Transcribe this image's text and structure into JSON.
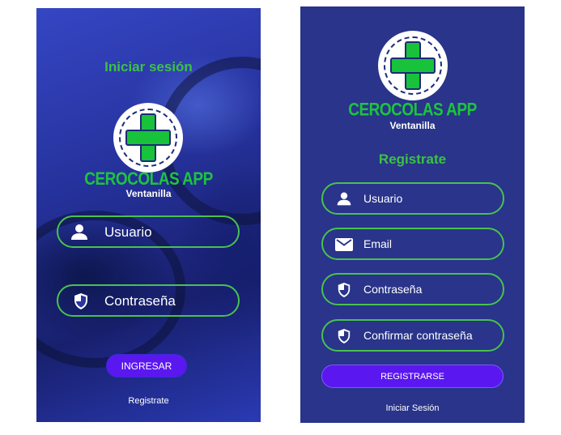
{
  "login": {
    "title": "Iniciar sesión",
    "brand": "CEROCOLAS APP",
    "subbrand": "Ventanilla",
    "fields": [
      {
        "label": "Usuario",
        "icon": "user-icon"
      },
      {
        "label": "Contraseña",
        "icon": "shield-icon"
      }
    ],
    "button": "INGRESAR",
    "link": "Registrate"
  },
  "register": {
    "brand": "CEROCOLAS APP",
    "subbrand": "Ventanilla",
    "title": "Registrate",
    "fields": [
      {
        "label": "Usuario",
        "icon": "user-icon"
      },
      {
        "label": "Email",
        "icon": "email-icon"
      },
      {
        "label": "Contraseña",
        "icon": "shield-icon"
      },
      {
        "label": "Confirmar contraseña",
        "icon": "shield-icon"
      }
    ],
    "button": "REGISTRARSE",
    "link": "Iniciar Sesión"
  },
  "colors": {
    "accent_green": "#3cc243",
    "button_purple": "#5b17f0",
    "register_bg": "#29348a"
  }
}
